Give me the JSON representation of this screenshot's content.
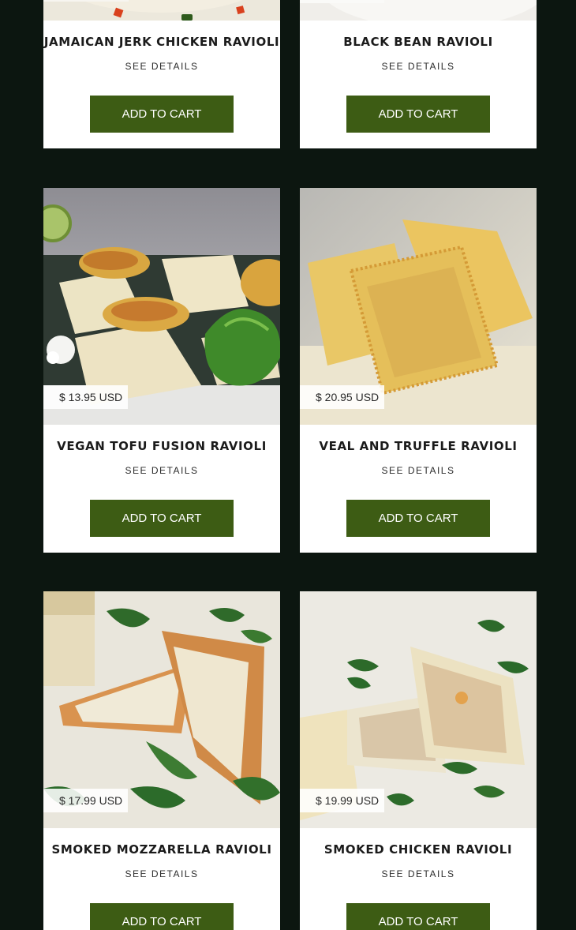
{
  "products": [
    {
      "name": "Jamaican Jerk Chicken Ravioli",
      "details_label": "SEE DETAILS",
      "cart_label": "ADD TO CART",
      "image": "ravioli-with-diced-tomatoes-photo"
    },
    {
      "name": "Black Bean Ravioli",
      "details_label": "SEE DETAILS",
      "cart_label": "ADD TO CART",
      "image": "black-bean-ravioli-photo"
    },
    {
      "name": "Vegan Tofu Fusion Ravioli",
      "price": "$ 13.95 USD",
      "details_label": "SEE DETAILS",
      "cart_label": "ADD TO CART",
      "image": "cut-ravioli-with-vegetable-filling-and-lettuce-photo"
    },
    {
      "name": "Veal and Truffle Ravioli",
      "price": "$ 20.95 USD",
      "details_label": "SEE DETAILS",
      "cart_label": "ADD TO CART",
      "image": "square-ravioli-on-semolina-photo"
    },
    {
      "name": "Smoked Mozzarella Ravioli",
      "price": "$ 17.99 USD",
      "details_label": "SEE DETAILS",
      "cart_label": "ADD TO CART",
      "image": "halved-triangle-ravioli-with-cheese-and-basil-photo"
    },
    {
      "name": "Smoked Chicken Ravioli",
      "price": "$ 19.99 USD",
      "details_label": "SEE DETAILS",
      "cart_label": "ADD TO CART",
      "image": "halved-chicken-ravioli-with-chives-photo"
    }
  ],
  "colors": {
    "page_background": "#0c1610",
    "card_background": "#ffffff",
    "button_background": "#3d5c14",
    "button_text": "#ffffff",
    "price_tag_background": "#ffffff"
  }
}
